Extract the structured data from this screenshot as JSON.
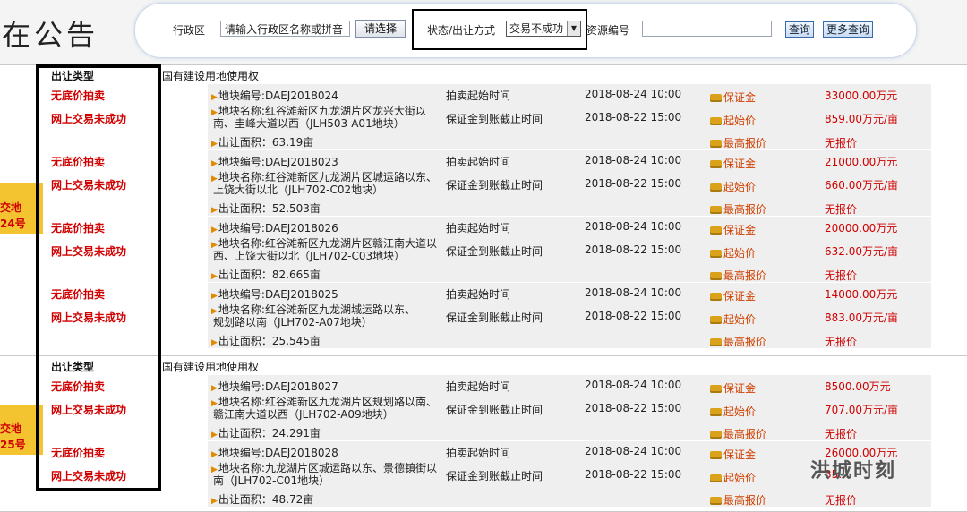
{
  "page": {
    "title": "在公告"
  },
  "search": {
    "region_label": "行政区",
    "region_input": "请输入行政区名称或拼音",
    "select_button": "请选择",
    "status_label": "状态/出让方式",
    "status_value": "交易不成功",
    "resource_label": "资源编号",
    "query_button": "查询",
    "more_query_button": "更多查询"
  },
  "side_badges": [
    {
      "line1": "交地",
      "line2": "24号"
    },
    {
      "line1": "交地",
      "line2": "25号"
    }
  ],
  "groups": [
    {
      "type_header": "出让类型",
      "land_type": "国有建设用地使用权",
      "rows": [
        {
          "method": "无底价拍卖",
          "status": "网上交易未成功",
          "code": "地块编号:DAEJ2018024",
          "name1": "地块名称:红谷滩新区九龙湖片区龙兴大街以",
          "name2": "南、圭峰大道以西（JLH503-A01地块）",
          "area": "出让面积：63.19亩",
          "start_label": "拍卖起始时间",
          "start_time": "2018-08-24 10:00",
          "deadline_label": "保证金到账截止时间",
          "deadline_time": "2018-08-22 15:00",
          "deposit_label": "保证金",
          "deposit": "33000.00万元",
          "start_price_label": "起始价",
          "start_price": "859.00万元/亩",
          "max_bid_label": "最高报价",
          "max_bid": "无报价"
        },
        {
          "method": "无底价拍卖",
          "status": "网上交易未成功",
          "code": "地块编号:DAEJ2018023",
          "name1": "地块名称:红谷滩新区九龙湖片区城运路以东、",
          "name2": "上饶大街以北（JLH702-C02地块）",
          "area": "出让面积：52.503亩",
          "start_label": "拍卖起始时间",
          "start_time": "2018-08-24 10:00",
          "deadline_label": "保证金到账截止时间",
          "deadline_time": "2018-08-22 15:00",
          "deposit_label": "保证金",
          "deposit": "21000.00万元",
          "start_price_label": "起始价",
          "start_price": "660.00万元/亩",
          "max_bid_label": "最高报价",
          "max_bid": "无报价"
        },
        {
          "method": "无底价拍卖",
          "status": "网上交易未成功",
          "code": "地块编号:DAEJ2018026",
          "name1": "地块名称:红谷滩新区九龙湖片区赣江南大道以",
          "name2": "西、上饶大街以北（JLH702-C03地块）",
          "area": "出让面积：82.665亩",
          "start_label": "拍卖起始时间",
          "start_time": "2018-08-24 10:00",
          "deadline_label": "保证金到账截止时间",
          "deadline_time": "2018-08-22 15:00",
          "deposit_label": "保证金",
          "deposit": "20000.00万元",
          "start_price_label": "起始价",
          "start_price": "632.00万元/亩",
          "max_bid_label": "最高报价",
          "max_bid": "无报价"
        },
        {
          "method": "无底价拍卖",
          "status": "网上交易未成功",
          "code": "地块编号:DAEJ2018025",
          "name1": "地块名称:红谷滩新区九龙湖城运路以东、",
          "name2": "规划路以南（JLH702-A07地块）",
          "area": "出让面积：25.545亩",
          "start_label": "拍卖起始时间",
          "start_time": "2018-08-24 10:00",
          "deadline_label": "保证金到账截止时间",
          "deadline_time": "2018-08-22 15:00",
          "deposit_label": "保证金",
          "deposit": "14000.00万元",
          "start_price_label": "起始价",
          "start_price": "883.00万元/亩",
          "max_bid_label": "最高报价",
          "max_bid": "无报价"
        }
      ]
    },
    {
      "type_header": "出让类型",
      "land_type": "国有建设用地使用权",
      "rows": [
        {
          "method": "无底价拍卖",
          "status": "网上交易未成功",
          "code": "地块编号:DAEJ2018027",
          "name1": "地块名称:红谷滩新区九龙湖片区规划路以南、",
          "name2": "赣江南大道以西（JLH702-A09地块）",
          "area": "出让面积：24.291亩",
          "start_label": "拍卖起始时间",
          "start_time": "2018-08-24 10:00",
          "deadline_label": "保证金到账截止时间",
          "deadline_time": "2018-08-22 15:00",
          "deposit_label": "保证金",
          "deposit": "8500.00万元",
          "start_price_label": "起始价",
          "start_price": "707.00万元/亩",
          "max_bid_label": "最高报价",
          "max_bid": "无报价"
        },
        {
          "method": "无底价拍卖",
          "status": "网上交易未成功",
          "code": "地块编号:DAEJ2018028",
          "name1": "地块名称:九龙湖片区城运路以东、景德镇街以",
          "name2": "南（JLH702-C01地块）",
          "area": "出让面积：48.72亩",
          "start_label": "拍卖起始时间",
          "start_time": "2018-08-24 10:00",
          "deadline_label": "保证金到账截止时间",
          "deadline_time": "2018-08-22 15:00",
          "deposit_label": "保证金",
          "deposit": "26000.00万元",
          "start_price_label": "起始价",
          "start_price": "35…",
          "max_bid_label": "最高报价",
          "max_bid": "无报价"
        }
      ]
    }
  ],
  "watermark": "洪城时刻"
}
